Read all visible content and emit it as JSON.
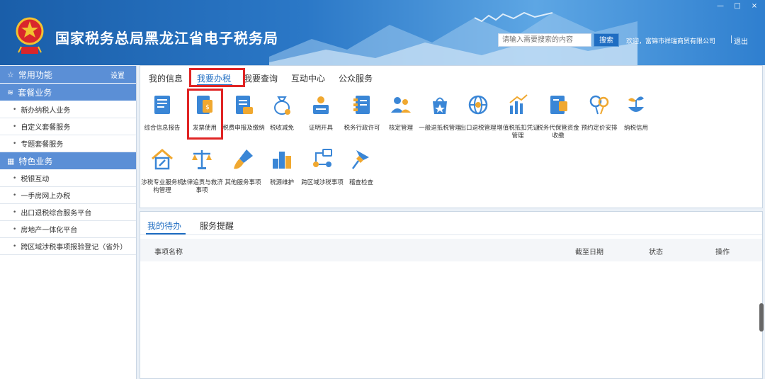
{
  "window": {
    "minimize": "—",
    "maximize": "□",
    "close": "×"
  },
  "header": {
    "title": "国家税务总局黑龙江省电子税务局",
    "search_placeholder": "请输入需要搜索的内容",
    "search_button": "搜索",
    "welcome": "欢迎，富锦市祥瑞商贸有限公司",
    "logout": "退出"
  },
  "sidebar": {
    "common": {
      "label": "常用功能",
      "settings": "设置"
    },
    "package": {
      "label": "套餐业务",
      "items": [
        "新办纳税人业务",
        "自定义套餐服务",
        "专题套餐服务"
      ]
    },
    "special": {
      "label": "特色业务",
      "items": [
        "税银互动",
        "一手房网上办税",
        "出口退税综合服务平台",
        "房地产一体化平台",
        "跨区域涉税事项报验登记（省外）"
      ]
    }
  },
  "tabs": [
    "我的信息",
    "我要办税",
    "我要查询",
    "互动中心",
    "公众服务"
  ],
  "active_tab": "我要办税",
  "grid": {
    "row1": [
      {
        "label": "综合信息报告",
        "icon": "report-icon"
      },
      {
        "label": "发票使用",
        "icon": "invoice-icon"
      },
      {
        "label": "税费申报及缴纳",
        "icon": "declare-icon"
      },
      {
        "label": "税收减免",
        "icon": "moneybag-icon"
      },
      {
        "label": "证明开具",
        "icon": "certificate-icon"
      },
      {
        "label": "税务行政许可",
        "icon": "license-icon"
      },
      {
        "label": "核定管理",
        "icon": "users-icon"
      },
      {
        "label": "一般退抵税管理",
        "icon": "refund-icon"
      },
      {
        "label": "出口退税管理",
        "icon": "globe-icon"
      },
      {
        "label": "增值税抵扣凭证管理",
        "icon": "chart-icon"
      },
      {
        "label": "税务代保管资金收缴",
        "icon": "safe-icon"
      },
      {
        "label": "预约定价安排",
        "icon": "balloon-icon"
      },
      {
        "label": "纳税信用",
        "icon": "plant-icon"
      }
    ],
    "row2": [
      {
        "label": "涉税专业服务机构管理",
        "icon": "house-tools-icon"
      },
      {
        "label": "法律追责与救济事项",
        "icon": "scales-icon"
      },
      {
        "label": "其他服务事项",
        "icon": "brush-icon"
      },
      {
        "label": "税源维护",
        "icon": "buildings-icon"
      },
      {
        "label": "跨区域涉税事项",
        "icon": "flow-icon"
      },
      {
        "label": "稽查检查",
        "icon": "pin-icon"
      }
    ]
  },
  "bottom": {
    "tabs": [
      "我的待办",
      "服务提醒"
    ],
    "columns": [
      "事项名称",
      "截至日期",
      "状态",
      "操作"
    ]
  },
  "colors": {
    "accent": "#1f6dc2",
    "highlight": "#e02424",
    "sidebar_head": "#5b8fd6"
  }
}
